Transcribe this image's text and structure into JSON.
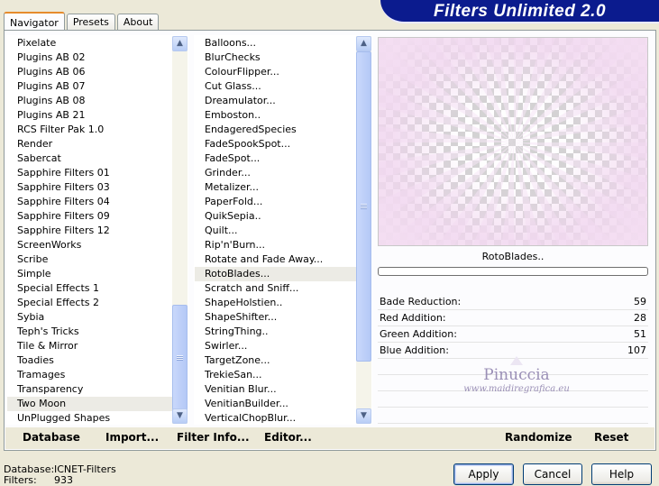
{
  "window": {
    "banner_title": "Filters Unlimited 2.0"
  },
  "tabs": [
    {
      "label": "Navigator",
      "active": true
    },
    {
      "label": "Presets",
      "active": false
    },
    {
      "label": "About",
      "active": false
    }
  ],
  "categories": {
    "items": [
      "Pixelate",
      "Plugins AB 02",
      "Plugins AB 06",
      "Plugins AB 07",
      "Plugins AB 08",
      "Plugins AB 21",
      "RCS Filter Pak 1.0",
      "Render",
      "Sabercat",
      "Sapphire Filters 01",
      "Sapphire Filters 03",
      "Sapphire Filters 04",
      "Sapphire Filters 09",
      "Sapphire Filters 12",
      "ScreenWorks",
      "Scribe",
      "Simple",
      "Special Effects 1",
      "Special Effects 2",
      "Sybia",
      "Teph's Tricks",
      "Tile & Mirror",
      "Toadies",
      "Tramages",
      "Transparency",
      "Two Moon",
      "UnPlugged Shapes"
    ],
    "selected": "Two Moon"
  },
  "filters": {
    "items": [
      "Balloons...",
      "BlurChecks",
      "ColourFlipper...",
      "Cut Glass...",
      "Dreamulator...",
      "Emboston..",
      "EndageredSpecies",
      "FadeSpookSpot...",
      "FadeSpot...",
      "Grinder...",
      "Metalizer...",
      "PaperFold...",
      "QuikSepia..",
      "Quilt...",
      "Rip'n'Burn...",
      "Rotate and Fade Away...",
      "RotoBlades...",
      "Scratch and Sniff...",
      "ShapeHolstien..",
      "ShapeShifter...",
      "StringThing..",
      "Swirler...",
      "TargetZone...",
      "TrekieSan...",
      "Venitian Blur...",
      "VenitianBuilder...",
      "VerticalChopBlur..."
    ],
    "selected": "RotoBlades..."
  },
  "preview": {
    "filter_name": "RotoBlades..",
    "progress": 0
  },
  "parameters": [
    {
      "label": "Bade Reduction:",
      "value": "59"
    },
    {
      "label": "Red Addition:",
      "value": "28"
    },
    {
      "label": "Green Addition:",
      "value": "51"
    },
    {
      "label": "Blue Addition:",
      "value": "107"
    }
  ],
  "watermark": {
    "title": "Pinuccia",
    "site": "www.maidiregrafica.eu"
  },
  "toolbar": {
    "database_label": "Database",
    "import_label": "Import...",
    "filter_info_label": "Filter Info...",
    "editor_label": "Editor...",
    "randomize_label": "Randomize",
    "reset_label": "Reset"
  },
  "footer": {
    "database_key": "Database:",
    "database_value": "ICNET-Filters",
    "filters_key": "Filters:",
    "filters_value": "933"
  },
  "buttons": {
    "apply": "Apply",
    "cancel": "Cancel",
    "help": "Help"
  },
  "icons": {
    "scroll_up": "chevron-up-icon",
    "scroll_down": "chevron-down-icon"
  },
  "colors": {
    "banner_bg": "#0b1b8e",
    "tab_accent": "#e68b2c",
    "preview_pink": "#f1d6ef"
  }
}
